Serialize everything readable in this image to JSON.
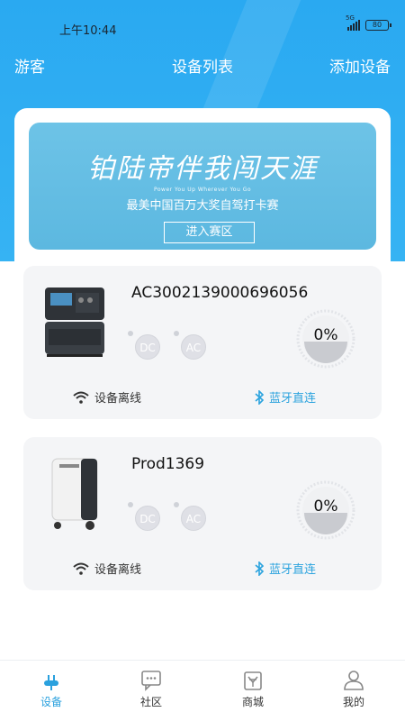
{
  "status_bar": {
    "time": "上午10:44",
    "network": "5G",
    "battery": "80"
  },
  "nav": {
    "left": "游客",
    "title": "设备列表",
    "right": "添加设备"
  },
  "banner": {
    "calligraphy": "铂陆帝伴我闯天涯",
    "slogan_en": "Power You Up Wherever You Go",
    "subtitle": "最美中国百万大奖自驾打卡赛",
    "button": "进入赛区"
  },
  "devices": [
    {
      "name": "AC3002139000696056",
      "dc": "DC",
      "ac": "AC",
      "percent": "0%",
      "wifi_status": "设备离线",
      "bt_label": "蓝牙直连"
    },
    {
      "name": "Prod1369",
      "dc": "DC",
      "ac": "AC",
      "percent": "0%",
      "wifi_status": "设备离线",
      "bt_label": "蓝牙直连"
    }
  ],
  "tabs": [
    {
      "label": "设备",
      "icon": "plug-icon",
      "active": true
    },
    {
      "label": "社区",
      "icon": "chat-icon",
      "active": false
    },
    {
      "label": "商城",
      "icon": "shop-bag-icon",
      "active": false
    },
    {
      "label": "我的",
      "icon": "user-icon",
      "active": false
    }
  ],
  "colors": {
    "accent": "#2aa9f1",
    "link": "#2ba3de",
    "card_bg": "#f4f5f7"
  }
}
